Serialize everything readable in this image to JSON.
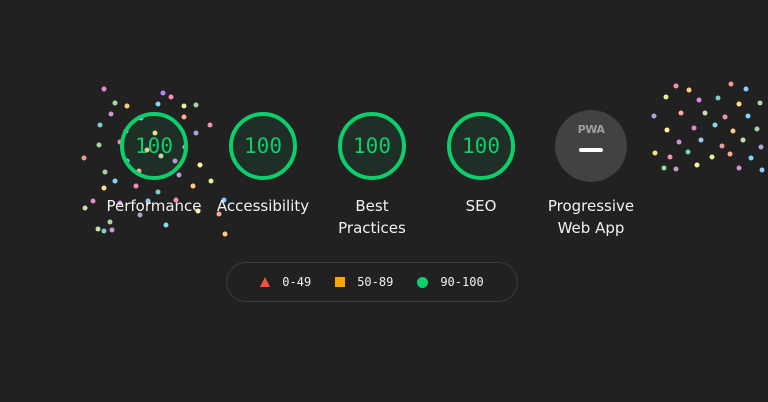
{
  "categories": [
    {
      "label": "Performance",
      "score": "100"
    },
    {
      "label": "Accessibility",
      "score": "100"
    },
    {
      "label": "Best Practices",
      "score": "100"
    },
    {
      "label": "SEO",
      "score": "100"
    },
    {
      "label": "Progressive Web App",
      "badge": "PWA"
    }
  ],
  "legend": {
    "fail": "0-49",
    "average": "50-89",
    "pass": "90-100"
  },
  "colors": {
    "background": "#212121",
    "pass": "#0cce6b",
    "average": "#ffa400",
    "fail": "#ff4e42",
    "pwa_badge": "#424242"
  }
}
